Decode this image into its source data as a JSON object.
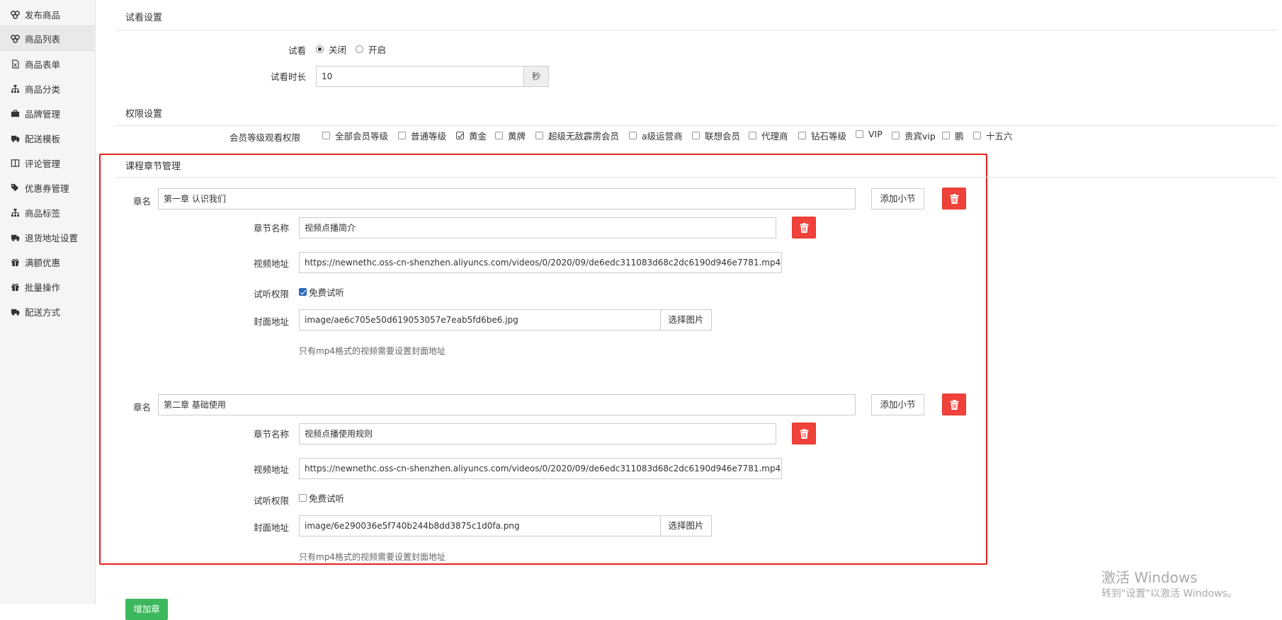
{
  "sidebar": {
    "items": [
      {
        "label": "发布商品",
        "icon": "cubes-icon"
      },
      {
        "label": "商品列表",
        "icon": "cubes-icon"
      },
      {
        "label": "商品表单",
        "icon": "file-icon"
      },
      {
        "label": "商品分类",
        "icon": "sitemap-icon"
      },
      {
        "label": "品牌管理",
        "icon": "briefcase-icon"
      },
      {
        "label": "配送模板",
        "icon": "truck-icon"
      },
      {
        "label": "评论管理",
        "icon": "columns-icon"
      },
      {
        "label": "优惠券管理",
        "icon": "tags-icon"
      },
      {
        "label": "商品标签",
        "icon": "sitemap-icon"
      },
      {
        "label": "退货地址设置",
        "icon": "truck-icon"
      },
      {
        "label": "满额优惠",
        "icon": "gift-icon"
      },
      {
        "label": "批量操作",
        "icon": "gift-icon"
      },
      {
        "label": "配送方式",
        "icon": "truck-icon"
      }
    ]
  },
  "trial": {
    "section_title": "试看设置",
    "trial_label": "试看",
    "off_label": "关闭",
    "on_label": "开启",
    "duration_label": "试看时长",
    "duration_value": "10",
    "duration_unit": "秒"
  },
  "permission": {
    "section_title": "权限设置",
    "label": "会员等级观看权限",
    "options": [
      {
        "label": "全部会员等级",
        "checked": false
      },
      {
        "label": "普通等级",
        "checked": false
      },
      {
        "label": "黄金",
        "checked": true
      },
      {
        "label": "黄牌",
        "checked": false
      },
      {
        "label": "超级无敌霹雳会员",
        "checked": false
      },
      {
        "label": "a级运营商",
        "checked": false
      },
      {
        "label": "联想会员",
        "checked": false
      },
      {
        "label": "代理商",
        "checked": false
      },
      {
        "label": "钻石等级",
        "checked": false
      },
      {
        "label": "VIP",
        "checked": false
      },
      {
        "label": "贵宾vip",
        "checked": false
      },
      {
        "label": "鹏",
        "checked": false
      },
      {
        "label": "十五六",
        "checked": false
      }
    ]
  },
  "chapters": {
    "section_title": "课程章节管理",
    "chapter_label": "章名",
    "add_section_label": "添加小节",
    "section_name_label": "章节名称",
    "video_url_label": "视频地址",
    "trial_perm_label": "试听权限",
    "free_trial_label": "免费试听",
    "cover_label": "封面地址",
    "choose_image_label": "选择图片",
    "hint": "只有mp4格式的视频需要设置封面地址",
    "items": [
      {
        "name": "第一章 认识我们",
        "section_name": "视频点播简介",
        "video_url": "https://newnethc.oss-cn-shenzhen.aliyuncs.com/videos/0/2020/09/de6edc311083d68c2dc6190d946e7781.mp4",
        "free_trial": true,
        "cover": "image/ae6c705e50d619053057e7eab5fd6be6.jpg"
      },
      {
        "name": "第二章 基础使用",
        "section_name": "视频点播使用规则",
        "video_url": "https://newnethc.oss-cn-shenzhen.aliyuncs.com/videos/0/2020/09/de6edc311083d68c2dc6190d946e7781.mp4",
        "free_trial": false,
        "cover": "image/6e290036e5f740b244b8dd3875c1d0fa.png"
      }
    ]
  },
  "add_chapter_label": "增加章",
  "watermark": {
    "line1": "激活 Windows",
    "line2": "转到\"设置\"以激活 Windows。"
  },
  "colors": {
    "danger": "#f0413a",
    "highlight_border": "#e8211d",
    "success": "#3cb85c"
  }
}
